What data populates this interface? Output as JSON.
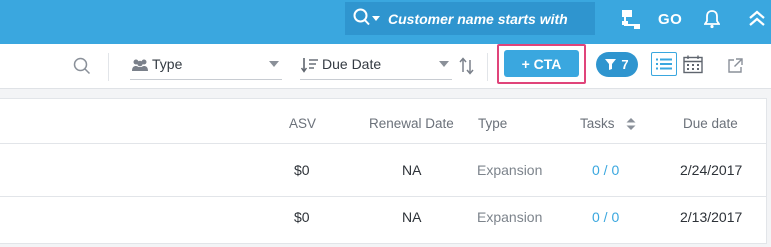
{
  "topbar": {
    "search": {
      "placeholder": "Customer name starts with"
    },
    "go_label": "GO",
    "icons": [
      "search-icon",
      "hierarchy-icon",
      "bell-icon",
      "collapse-icon"
    ],
    "accent": "#3aa7df"
  },
  "toolbar": {
    "type_dropdown": {
      "value": "Type"
    },
    "sort_dropdown": {
      "value": "Due Date"
    },
    "cta_button": {
      "label": "+ CTA"
    },
    "filter_badge": {
      "count": "7"
    },
    "highlight_color": "#e0447a"
  },
  "table": {
    "columns": [
      "ASV",
      "Renewal Date",
      "Type",
      "Tasks",
      "Due date"
    ],
    "rows": [
      {
        "asv": "$0",
        "renewal_date": "NA",
        "type": "Expansion",
        "tasks": "0 / 0",
        "due_date": "2/24/2017"
      },
      {
        "asv": "$0",
        "renewal_date": "NA",
        "type": "Expansion",
        "tasks": "0 / 0",
        "due_date": "2/13/2017"
      }
    ]
  }
}
